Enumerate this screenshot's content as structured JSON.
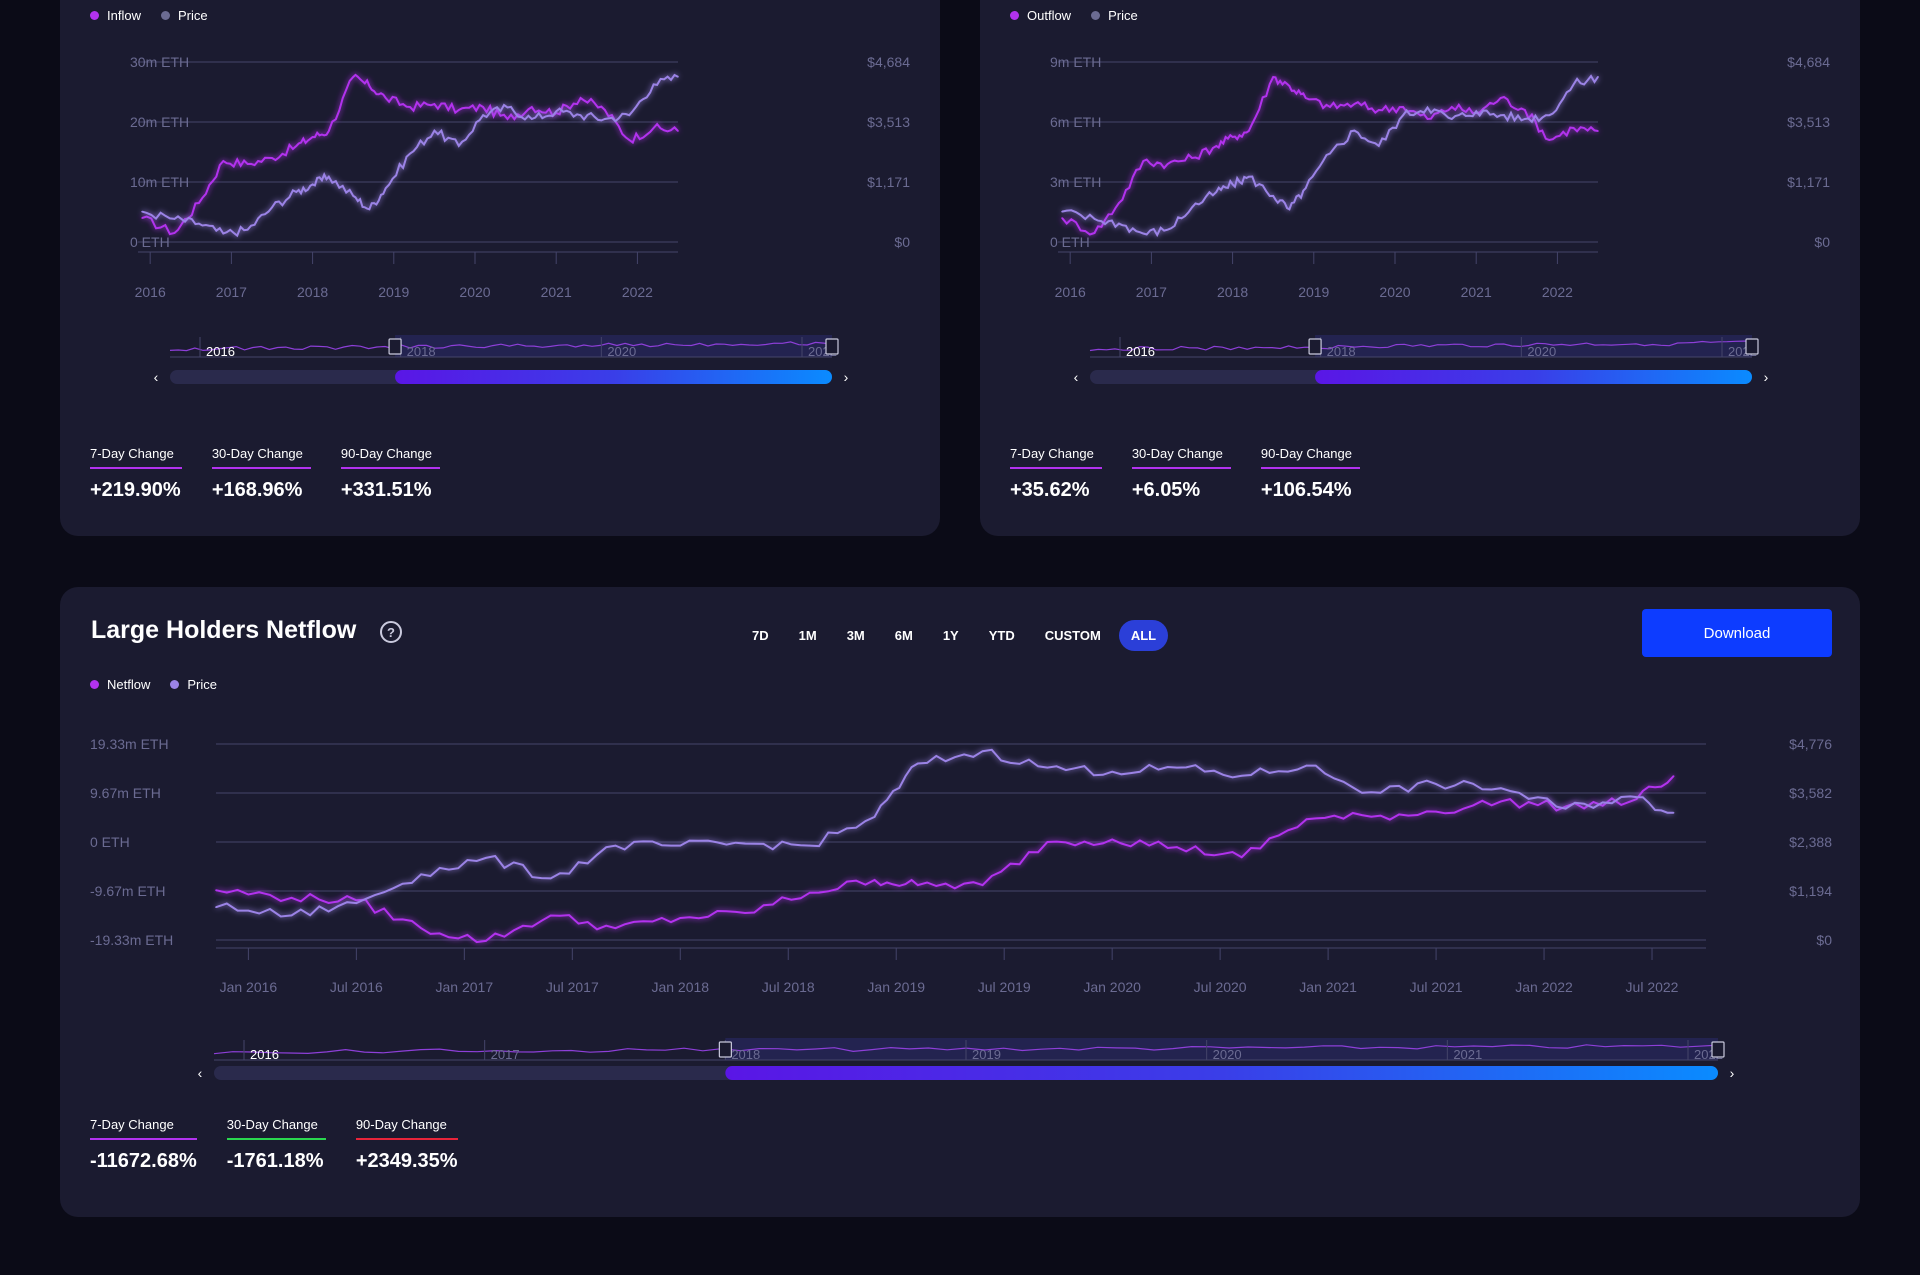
{
  "colors": {
    "flow": "#b232ee",
    "price": "#9b83e6",
    "grid": "#44446a",
    "axis_text": "#6b6b92"
  },
  "cards": [
    {
      "id": "inflow",
      "legend": [
        {
          "label": "Inflow",
          "color": "#b232ee"
        },
        {
          "label": "Price",
          "color": "#6b6b92"
        }
      ],
      "stats": [
        {
          "label": "7-Day Change",
          "value": "+219.90%",
          "color": "#b232ee"
        },
        {
          "label": "30-Day Change",
          "value": "+168.96%",
          "color": "#b232ee"
        },
        {
          "label": "90-Day Change",
          "value": "+331.51%",
          "color": "#b232ee"
        }
      ],
      "navigator_labels": [
        "2016",
        "2018",
        "2020",
        "2022"
      ]
    },
    {
      "id": "outflow",
      "legend": [
        {
          "label": "Outflow",
          "color": "#b232ee"
        },
        {
          "label": "Price",
          "color": "#6b6b92"
        }
      ],
      "stats": [
        {
          "label": "7-Day Change",
          "value": "+35.62%",
          "color": "#b232ee"
        },
        {
          "label": "30-Day Change",
          "value": "+6.05%",
          "color": "#b232ee"
        },
        {
          "label": "90-Day Change",
          "value": "+106.54%",
          "color": "#b232ee"
        }
      ],
      "navigator_labels": [
        "2016",
        "2018",
        "2020",
        "2022"
      ]
    },
    {
      "id": "netflow",
      "title": "Large Holders Netflow",
      "help": "?",
      "download_label": "Download",
      "ranges": [
        "7D",
        "1M",
        "3M",
        "6M",
        "1Y",
        "YTD",
        "CUSTOM",
        "ALL"
      ],
      "active_range": "ALL",
      "legend": [
        {
          "label": "Netflow",
          "color": "#b232ee"
        },
        {
          "label": "Price",
          "color": "#9b83e6"
        }
      ],
      "stats": [
        {
          "label": "7-Day Change",
          "value": "-11672.68%",
          "color": "#b232ee"
        },
        {
          "label": "30-Day Change",
          "value": "-1761.18%",
          "color": "#2ad64f"
        },
        {
          "label": "90-Day Change",
          "value": "+2349.35%",
          "color": "#e8243a"
        }
      ],
      "navigator_labels": [
        "2016",
        "2017",
        "2018",
        "2019",
        "2020",
        "2021",
        "2022"
      ]
    }
  ],
  "chart_data": [
    {
      "type": "line",
      "x_ticks": [
        "2016",
        "2017",
        "2018",
        "2019",
        "2020",
        "2021",
        "2022"
      ],
      "y_left_ticks": [
        "30m ETH",
        "20m ETH",
        "10m ETH",
        "0 ETH"
      ],
      "y_right_ticks": [
        "$4,684",
        "$3,513",
        "$1,171",
        "$0"
      ],
      "x": [
        2015.9,
        2016.3,
        2016.6,
        2016.9,
        2017.2,
        2017.5,
        2017.8,
        2018.0,
        2018.2,
        2018.5,
        2018.7,
        2018.9,
        2019.2,
        2019.5,
        2019.8,
        2020.1,
        2020.4,
        2020.7,
        2021.0,
        2021.3,
        2021.6,
        2021.9,
        2022.2,
        2022.5
      ],
      "series": [
        {
          "name": "Inflow",
          "unit": "m ETH",
          "values": [
            4.0,
            1.5,
            6.5,
            13.5,
            13.0,
            14.0,
            16.0,
            17.5,
            18.5,
            27.5,
            26.0,
            24.0,
            22.5,
            23.0,
            22.0,
            22.5,
            20.5,
            22.5,
            21.5,
            24.0,
            22.0,
            17.0,
            19.0,
            18.5
          ]
        },
        {
          "name": "Price",
          "unit": "$",
          "values": [
            790,
            600,
            480,
            220,
            320,
            900,
            1300,
            1500,
            1700,
            1200,
            850,
            1400,
            2300,
            2900,
            2500,
            3300,
            3500,
            3200,
            3400,
            3300,
            3200,
            3300,
            4100,
            4300
          ]
        }
      ]
    },
    {
      "type": "line",
      "x_ticks": [
        "2016",
        "2017",
        "2018",
        "2019",
        "2020",
        "2021",
        "2022"
      ],
      "y_left_ticks": [
        "9m ETH",
        "6m ETH",
        "3m ETH",
        "0 ETH"
      ],
      "y_right_ticks": [
        "$4,684",
        "$3,513",
        "$1,171",
        "$0"
      ],
      "x": [
        2015.9,
        2016.3,
        2016.6,
        2016.9,
        2017.2,
        2017.5,
        2017.8,
        2018.0,
        2018.2,
        2018.5,
        2018.7,
        2018.9,
        2019.2,
        2019.5,
        2019.8,
        2020.1,
        2020.4,
        2020.7,
        2021.0,
        2021.3,
        2021.6,
        2021.9,
        2022.2,
        2022.5
      ],
      "series": [
        {
          "name": "Outflow",
          "unit": "m ETH",
          "values": [
            1.2,
            0.45,
            1.95,
            4.05,
            3.9,
            4.2,
            4.8,
            5.25,
            5.55,
            8.25,
            7.8,
            7.2,
            6.75,
            6.9,
            6.6,
            6.75,
            6.15,
            6.75,
            6.45,
            7.2,
            6.6,
            5.1,
            5.7,
            5.55
          ]
        },
        {
          "name": "Price",
          "unit": "$",
          "values": [
            790,
            600,
            480,
            220,
            320,
            900,
            1300,
            1500,
            1700,
            1200,
            850,
            1400,
            2300,
            2900,
            2500,
            3300,
            3500,
            3200,
            3400,
            3300,
            3200,
            3300,
            4100,
            4300
          ]
        }
      ]
    },
    {
      "type": "line",
      "title": "Large Holders Netflow",
      "x_ticks": [
        "Jan 2016",
        "Jul 2016",
        "Jan 2017",
        "Jul 2017",
        "Jan 2018",
        "Jul 2018",
        "Jan 2019",
        "Jul 2019",
        "Jan 2020",
        "Jul 2020",
        "Jan 2021",
        "Jul 2021",
        "Jan 2022",
        "Jul 2022"
      ],
      "y_left_ticks": [
        "19.33m ETH",
        "9.67m ETH",
        "0 ETH",
        "-9.67m ETH",
        "-19.33m ETH"
      ],
      "y_right_ticks": [
        "$4,776",
        "$3,582",
        "$2,388",
        "$1,194",
        "$0"
      ],
      "x": [
        2015.85,
        2016.2,
        2016.5,
        2016.8,
        2017.1,
        2017.4,
        2017.7,
        2018.0,
        2018.3,
        2018.6,
        2018.9,
        2019.1,
        2019.4,
        2019.7,
        2020.0,
        2020.3,
        2020.6,
        2020.9,
        2021.2,
        2021.5,
        2021.8,
        2022.1,
        2022.4,
        2022.6
      ],
      "series": [
        {
          "name": "Netflow",
          "unit": "m ETH",
          "values": [
            -9.5,
            -11.0,
            -11.5,
            -17.0,
            -19.5,
            -14.5,
            -17.0,
            -15.0,
            -14.0,
            -10.0,
            -7.5,
            -8.5,
            -8.5,
            0.0,
            0.5,
            -1.0,
            -3.0,
            4.5,
            5.0,
            6.0,
            8.0,
            7.0,
            8.0,
            13.0
          ]
        },
        {
          "name": "Price",
          "unit": "$",
          "values": [
            800,
            600,
            900,
            1600,
            2000,
            1500,
            2300,
            2300,
            2350,
            2300,
            3000,
            4300,
            4600,
            4200,
            4100,
            4200,
            4000,
            4250,
            3600,
            3800,
            3700,
            3200,
            3500,
            3100
          ]
        }
      ]
    }
  ]
}
